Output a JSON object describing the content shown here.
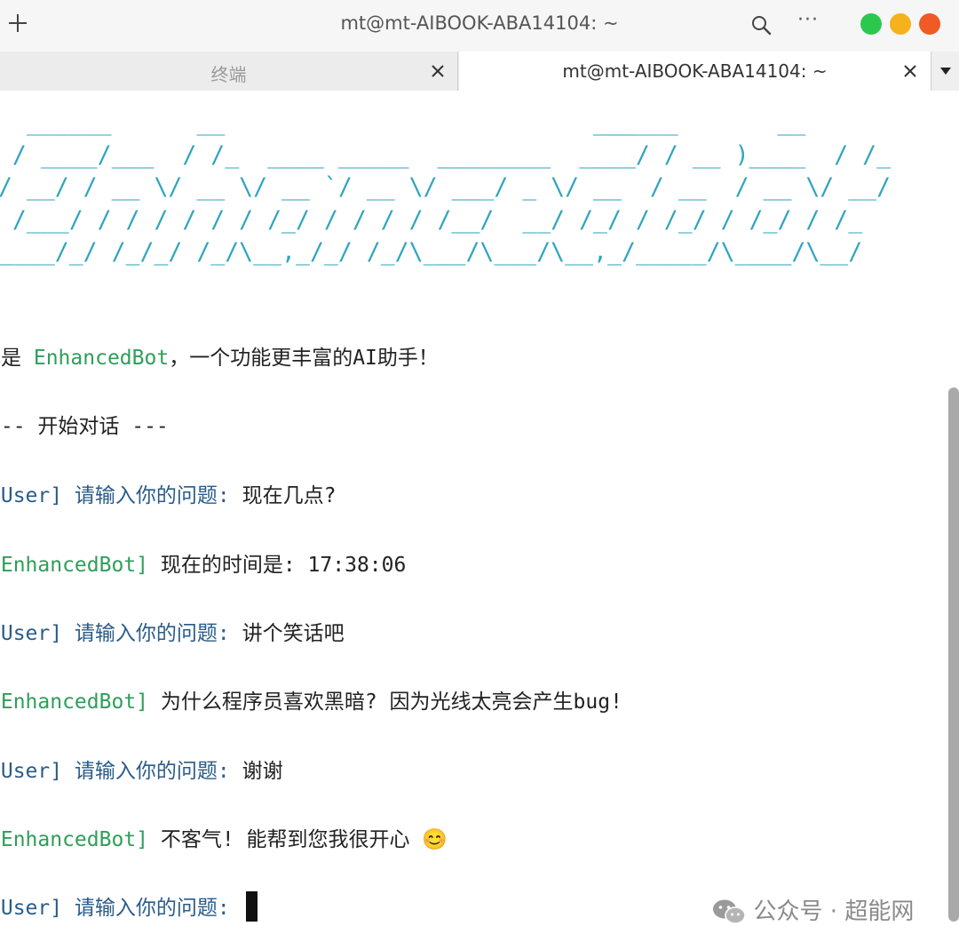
{
  "window": {
    "title": "mt@mt-AIBOOK-ABA14104: ~",
    "controls": {
      "green": "#2cc84d",
      "yellow": "#f5b21c",
      "red": "#f05a24"
    }
  },
  "tabs": [
    {
      "label": "终端",
      "active": false
    },
    {
      "label": "mt@mt-AIBOOK-ABA14104: ~",
      "active": true
    }
  ],
  "terminal": {
    "banner_color": "#2fa5c0",
    "banner": "   ______      __                          ______       __\n  / ____/___  / /_  ____ _____  ________  ____/ / __ )____  / /_\n / __/ / __ \\/ __ \\/ __ `/ __ \\/ ___/ _ \\/ __  / __  / __ \\/ __/\n/ /___/ / / / / / / /_/ / / / / /__/  __/ /_/ / /_/ / /_/ / /_\n_____/_/ /_/_/ /_/\\__,_/_/ /_/\\___/\\___/\\__,_/_____/\\____/\\__/",
    "intro": {
      "prefix": "我是 ",
      "bot_name": "EnhancedBot",
      "suffix": "，一个功能更丰富的AI助手！"
    },
    "divider": "--- 开始对话 ---",
    "user_prompt": "[User] 请输入你的问题: ",
    "bot_tag": "[EnhancedBot]",
    "messages": [
      {
        "role": "user",
        "text": "现在几点?"
      },
      {
        "role": "bot",
        "text": " 现在的时间是: 17:38:06"
      },
      {
        "role": "user",
        "text": "讲个笑话吧"
      },
      {
        "role": "bot",
        "text": " 为什么程序员喜欢黑暗? 因为光线太亮会产生bug!"
      },
      {
        "role": "user",
        "text": "谢谢"
      },
      {
        "role": "bot",
        "text": " 不客气! 能帮到您我很开心 😊"
      }
    ],
    "current_prompt": "[User] 请输入你的问题: "
  },
  "watermark": {
    "text": "公众号 · 超能网",
    "icon": "wechat-icon"
  },
  "colors": {
    "user": "#2a5c8a",
    "bot": "#2f9e59",
    "text": "#222222"
  }
}
